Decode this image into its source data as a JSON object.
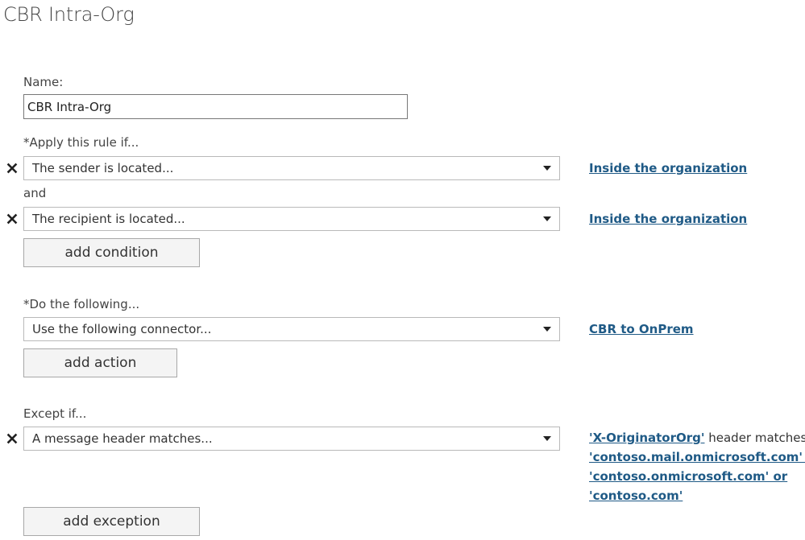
{
  "page": {
    "title": "CBR Intra-Org"
  },
  "name_field": {
    "label": "Name:",
    "value": "CBR Intra-Org"
  },
  "conditions": {
    "label": "*Apply this rule if...",
    "conjunction": "and",
    "items": [
      {
        "dropdown": "The sender is located...",
        "value_link": "Inside the organization"
      },
      {
        "dropdown": "The recipient is located...",
        "value_link": "Inside the organization"
      }
    ],
    "add_label": "add condition"
  },
  "actions": {
    "label": "*Do the following...",
    "items": [
      {
        "dropdown": "Use the following connector...",
        "value_link": "CBR to OnPrem"
      }
    ],
    "add_label": "add action"
  },
  "exceptions": {
    "label": "Except if...",
    "items": [
      {
        "dropdown": "A message header matches...",
        "header_link": "'X-OriginatorOrg'",
        "header_text": " header matches",
        "values": {
          "v1": "'contoso.mail.onmicrosoft.com' or",
          "v2": "'contoso.onmicrosoft.com' or",
          "v3": "'contoso.com'"
        }
      }
    ],
    "add_label": "add exception"
  },
  "icons": {
    "remove": "close-x-icon",
    "dropdown": "chevron-down-icon"
  },
  "colors": {
    "link": "#1f5a86",
    "text": "#333333"
  }
}
